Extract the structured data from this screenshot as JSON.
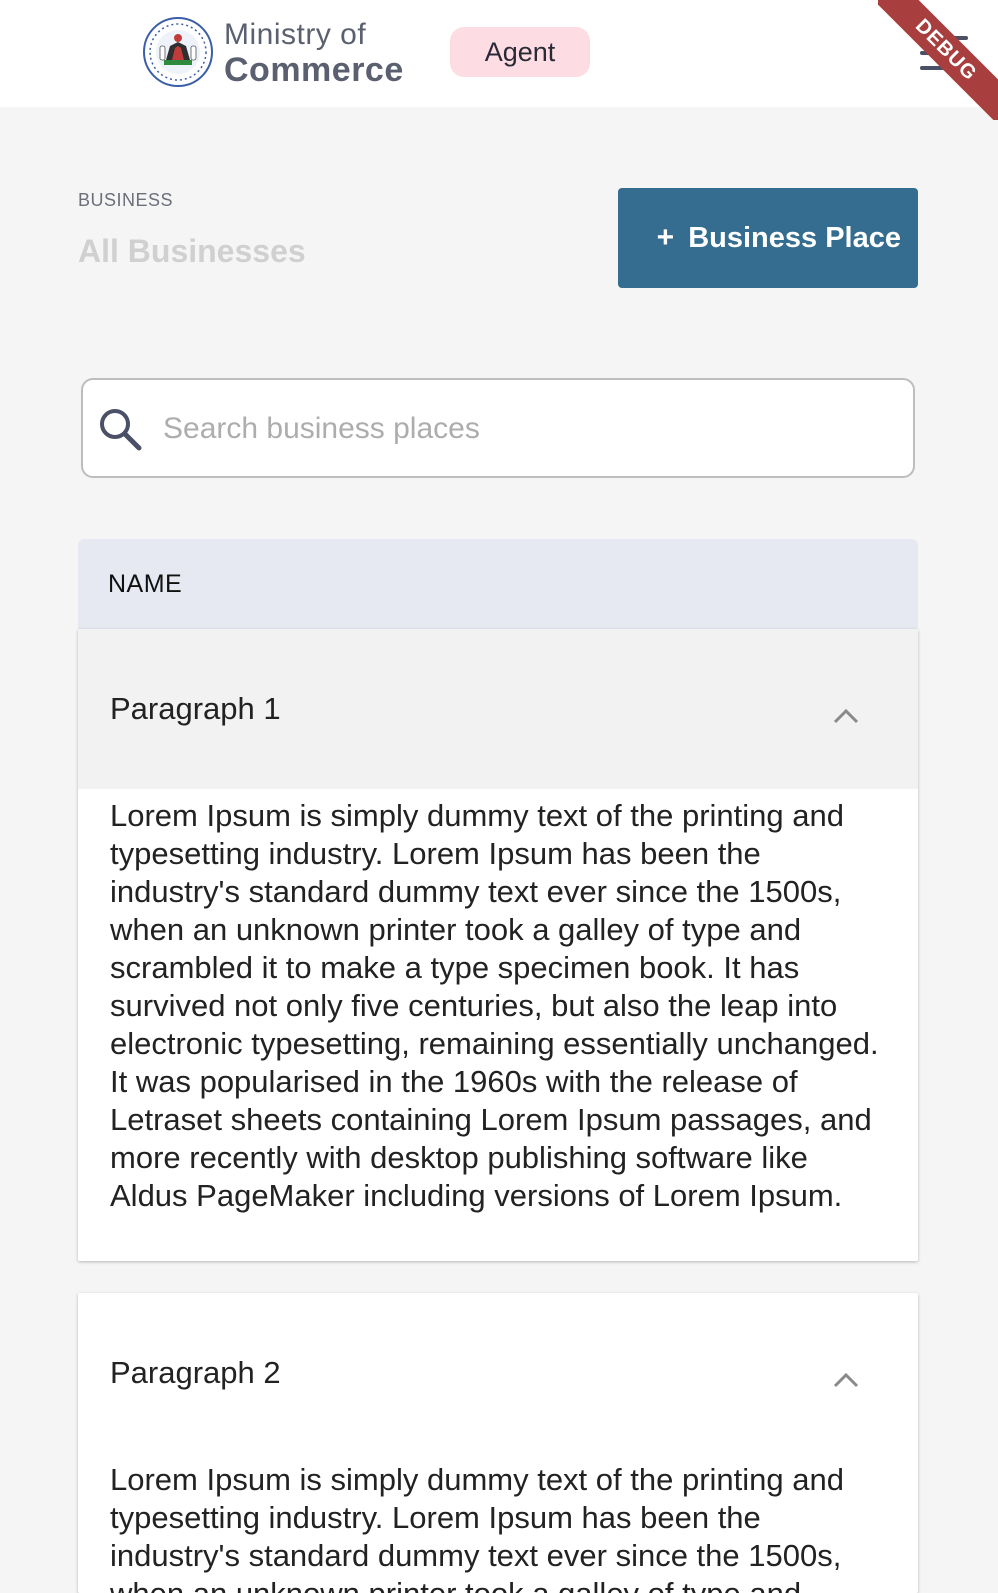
{
  "header": {
    "brand_line1": "Ministry of",
    "brand_line2": "Commerce",
    "role_badge": "Agent",
    "debug_label": "DEBUG"
  },
  "page": {
    "section_label": "BUSINESS",
    "title": "All Businesses",
    "add_button_label": "Business Place"
  },
  "search": {
    "placeholder": "Search business places",
    "value": ""
  },
  "table": {
    "column_header": "NAME",
    "rows": [
      {
        "title": "Paragraph 1",
        "expanded": true,
        "body": "Lorem Ipsum is simply dummy text of the printing and typesetting industry. Lorem Ipsum has been the industry's standard dummy text ever since the 1500s, when an unknown printer took a galley of type and scrambled it to make a type specimen book. It has survived not only five centuries, but also the leap into electronic typesetting, remaining essentially unchanged. It was popularised in the 1960s with the release of Letraset sheets containing Lorem Ipsum passages, and more recently with desktop publishing software like Aldus PageMaker including versions of Lorem Ipsum."
      },
      {
        "title": "Paragraph 2",
        "expanded": true,
        "body": "Lorem Ipsum is simply dummy text of the printing and typesetting industry. Lorem Ipsum has been the industry's standard dummy text ever since the 1500s, when an unknown printer took a galley of type and scrambled it to make a type specimen book."
      }
    ]
  },
  "colors": {
    "primary": "#346d8f",
    "badge_bg": "#fddde3",
    "table_header_bg": "#e6e9f1",
    "debug_ribbon": "#a83e3e"
  },
  "icons": {
    "logo": "coat-of-arms-icon",
    "menu": "hamburger-menu-icon",
    "search": "search-icon",
    "add": "plus-icon",
    "expand": "chevron-up-icon"
  }
}
